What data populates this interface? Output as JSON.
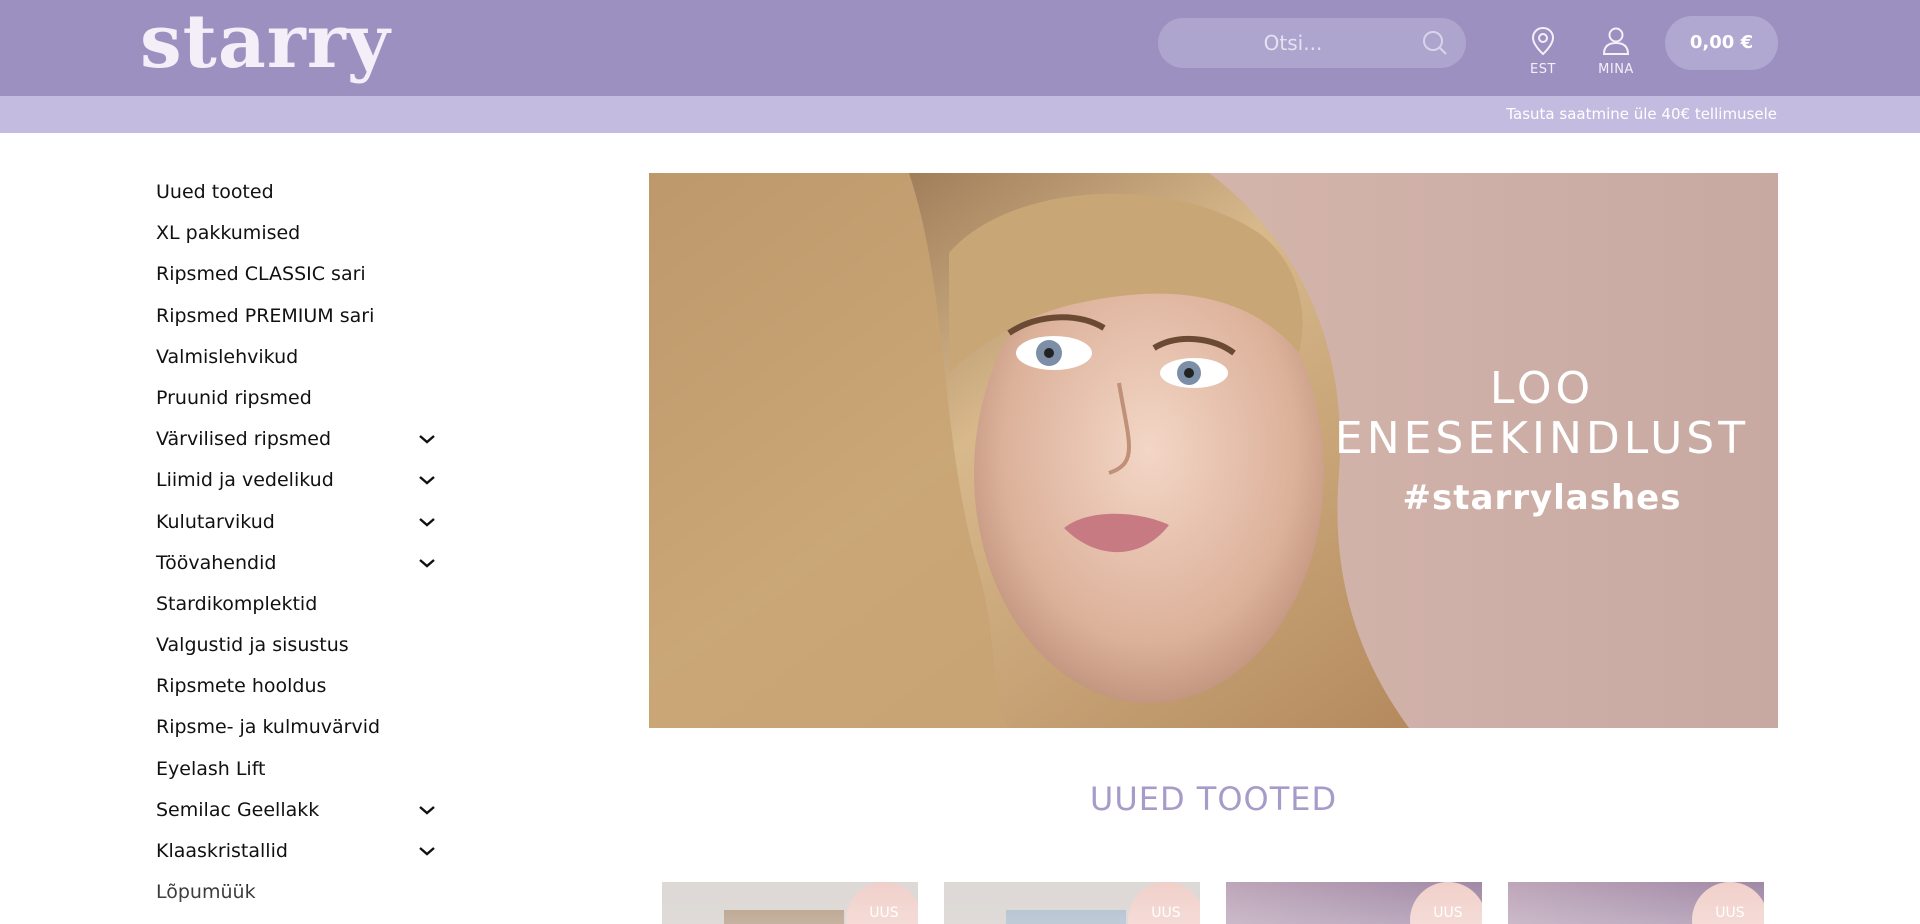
{
  "header": {
    "logo": "starry",
    "search": {
      "placeholder": "Otsi...",
      "value": ""
    },
    "locale": {
      "label": "EST",
      "icon": "map-pin-icon"
    },
    "account": {
      "label": "MINA",
      "icon": "user-icon"
    },
    "cart": {
      "total": "0,00 €"
    }
  },
  "promo": {
    "text": "Tasuta saatmine üle 40€ tellimusele"
  },
  "sidebar": {
    "items": [
      {
        "label": "Uued tooted",
        "expandable": false
      },
      {
        "label": "XL pakkumised",
        "expandable": false
      },
      {
        "label": "Ripsmed CLASSIC sari",
        "expandable": false
      },
      {
        "label": "Ripsmed PREMIUM sari",
        "expandable": false
      },
      {
        "label": "Valmislehvikud",
        "expandable": false
      },
      {
        "label": "Pruunid ripsmed",
        "expandable": false
      },
      {
        "label": "Värvilised ripsmed",
        "expandable": true
      },
      {
        "label": "Liimid ja vedelikud",
        "expandable": true
      },
      {
        "label": "Kulutarvikud",
        "expandable": true
      },
      {
        "label": "Töövahendid",
        "expandable": true
      },
      {
        "label": "Stardikomplektid",
        "expandable": false
      },
      {
        "label": "Valgustid ja sisustus",
        "expandable": false
      },
      {
        "label": "Ripsmete hooldus",
        "expandable": false
      },
      {
        "label": "Ripsme- ja kulmuvärvid",
        "expandable": false
      },
      {
        "label": "Eyelash Lift",
        "expandable": false
      },
      {
        "label": "Semilac Geellakk",
        "expandable": true
      },
      {
        "label": "Klaaskristallid",
        "expandable": true
      },
      {
        "label": "Lõpumüük",
        "expandable": false
      }
    ]
  },
  "hero": {
    "line1": "LOO",
    "line2": "ENESEKINDLUST",
    "line3": "#starrylashes"
  },
  "new_products": {
    "title": "UUED TOOTED",
    "cards": [
      {
        "badge": "UUS"
      },
      {
        "badge": "UUS"
      },
      {
        "badge": "UUS"
      },
      {
        "badge": "UUS"
      }
    ]
  },
  "colors": {
    "header_bg": "#9b90c0",
    "promo_bg": "#c3bce0",
    "accent": "#a79bc9",
    "badge": "#efc9c2"
  }
}
